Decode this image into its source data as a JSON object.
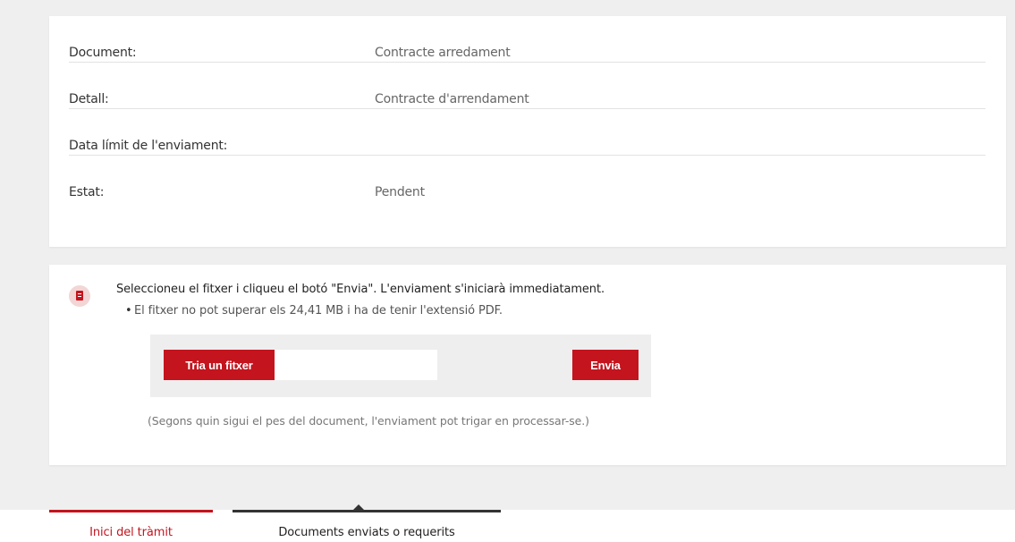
{
  "details": {
    "rows": [
      {
        "label": "Document:",
        "value": "Contracte arredament"
      },
      {
        "label": "Detall:",
        "value": "Contracte d'arrendament"
      },
      {
        "label": "Data límit de l'enviament:",
        "value": ""
      },
      {
        "label": "Estat:",
        "value": "Pendent"
      }
    ]
  },
  "upload": {
    "icon": "document-icon",
    "instructions": "Seleccioneu el fitxer i cliqueu el botó \"Envia\". L'enviament s'iniciarà immediatament.",
    "bullet": "El fitxer no pot superar els 24,41 MB i ha de tenir l'extensió PDF.",
    "choose_label": "Tria un fitxer",
    "send_label": "Envia",
    "note": "(Segons quin sigui el pes del document, l'enviament pot trigar en processar-se.)"
  },
  "tabs": [
    {
      "label": "Inici del tràmit"
    },
    {
      "label": "Documents enviats o requerits"
    }
  ],
  "colors": {
    "accent": "#c4141e",
    "background": "#efefef"
  }
}
